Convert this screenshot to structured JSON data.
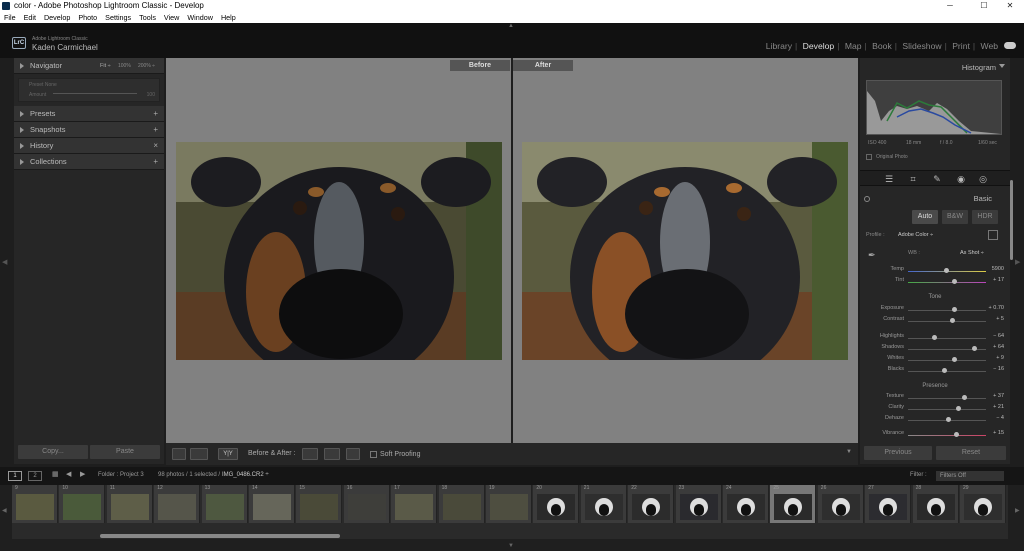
{
  "window": {
    "title": "color - Adobe Photoshop Lightroom Classic - Develop",
    "min": "─",
    "max": "☐",
    "close": "✕"
  },
  "menu": [
    "File",
    "Edit",
    "Develop",
    "Photo",
    "Settings",
    "Tools",
    "View",
    "Window",
    "Help"
  ],
  "identity": {
    "logo": "LrC",
    "app": "Adobe Lightroom Classic",
    "user": "Kaden Carmichael"
  },
  "modules": [
    "Library",
    "Develop",
    "Map",
    "Book",
    "Slideshow",
    "Print",
    "Web"
  ],
  "left": {
    "navigator": {
      "label": "Navigator",
      "fit": "Fit ÷",
      "z1": "100%",
      "z2": "200% ÷"
    },
    "preset_preview": {
      "line1": "Preset   None",
      "line2": "Amount",
      "val": "100"
    },
    "panels": [
      {
        "label": "Presets",
        "action": "+"
      },
      {
        "label": "Snapshots",
        "action": "+"
      },
      {
        "label": "History",
        "action": "×"
      },
      {
        "label": "Collections",
        "action": "+"
      }
    ],
    "copy": "Copy...",
    "paste": "Paste"
  },
  "center": {
    "before": "Before",
    "after": "After"
  },
  "toolbar": {
    "ya": "Y|Y",
    "ba_label": "Before & After :",
    "soft": "Soft Proofing"
  },
  "right": {
    "histogram": "Histogram",
    "meta": [
      "ISO 400",
      "18 mm",
      "f / 8.0",
      "1/60 sec"
    ],
    "original": "Original Photo",
    "basic": "Basic",
    "treat": [
      "Auto",
      "B&W",
      "HDR"
    ],
    "profile_label": "Profile :",
    "profile": "Adobe Color ÷",
    "wb_label": "WB :",
    "wb": "As Shot ÷",
    "temp": {
      "label": "Temp",
      "val": "5900"
    },
    "tint": {
      "label": "Tint",
      "val": "+ 17"
    },
    "tone": "Tone",
    "exposure": {
      "label": "Exposure",
      "val": "+ 0.70"
    },
    "contrast": {
      "label": "Contrast",
      "val": "+ 5"
    },
    "highlights": {
      "label": "Highlights",
      "val": "− 64"
    },
    "shadows": {
      "label": "Shadows",
      "val": "+ 64"
    },
    "whites": {
      "label": "Whites",
      "val": "+ 9"
    },
    "blacks": {
      "label": "Blacks",
      "val": "− 16"
    },
    "presence": "Presence",
    "texture": {
      "label": "Texture",
      "val": "+ 37"
    },
    "clarity": {
      "label": "Clarity",
      "val": "+ 21"
    },
    "dehaze": {
      "label": "Dehaze",
      "val": "− 4"
    },
    "vibrance": {
      "label": "Vibrance",
      "val": "+ 15"
    },
    "previous": "Previous",
    "reset": "Reset"
  },
  "filmstrip": {
    "pages": [
      "1",
      "2"
    ],
    "source": "Folder : Project 3",
    "count": "98 photos / 1 selected /",
    "file": "IMG_0486.CR2 ÷",
    "filter_label": "Filter :",
    "filter": "Filters Off",
    "frames": [
      "9",
      "10",
      "11",
      "12",
      "13",
      "14",
      "15",
      "16",
      "17",
      "18",
      "19",
      "20",
      "21",
      "22",
      "23",
      "24",
      "25",
      "26",
      "27",
      "28",
      "29"
    ],
    "selected": "25"
  },
  "colors": {
    "accent": "#dddddd",
    "panel": "#262626",
    "bg": "#1e1e1e"
  }
}
